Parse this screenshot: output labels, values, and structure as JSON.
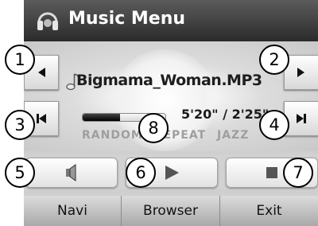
{
  "header": {
    "title": "Music Menu",
    "icon": "headphones-icon"
  },
  "track": {
    "name": "Bigmama_Woman.MP3",
    "time": "5'20\" / 2'25\"",
    "progress_fraction": 0.45
  },
  "modes": [
    "RANDOM",
    "REPEAT",
    "JAZZ"
  ],
  "side_buttons": {
    "prev_folder": "triangle-left-icon",
    "next_folder": "triangle-right-icon",
    "prev_track": "skip-back-icon",
    "next_track": "skip-forward-icon"
  },
  "controls": {
    "volume": "speaker-icon",
    "play": "play-icon",
    "stop": "stop-icon"
  },
  "nav": {
    "navi": "Navi",
    "browser": "Browser",
    "exit": "Exit"
  },
  "callouts": [
    "1",
    "2",
    "3",
    "4",
    "5",
    "6",
    "7",
    "8"
  ],
  "colors": {
    "titlebar": "#2b2b2b",
    "progress_fill": "#000000"
  }
}
